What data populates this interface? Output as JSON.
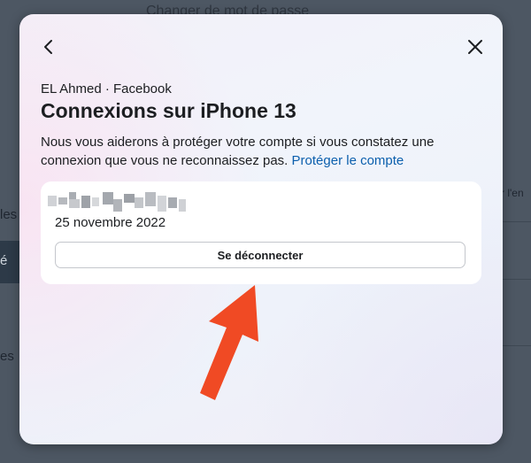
{
  "background": {
    "top_text": "Changer de mot de passe",
    "left_text_1": "les",
    "left_text_2": "é",
    "left_text_3": "es",
    "right_text": "r l'en"
  },
  "modal": {
    "back_icon": "chevron-left-icon",
    "close_icon": "close-x-icon",
    "account_line": "EL Ahmed · Facebook",
    "title": "Connexions sur iPhone 13",
    "description": "Nous vous aiderons à protéger votre compte si vous constatez une connexion que vous ne reconnaissez pas.",
    "protect_link": "Protéger le compte",
    "session": {
      "date": "25 novembre 2022",
      "logout_label": "Se déconnecter"
    }
  },
  "colors": {
    "link": "#0b5fad",
    "arrow": "#f04a24",
    "backdrop": "#4d5763"
  }
}
